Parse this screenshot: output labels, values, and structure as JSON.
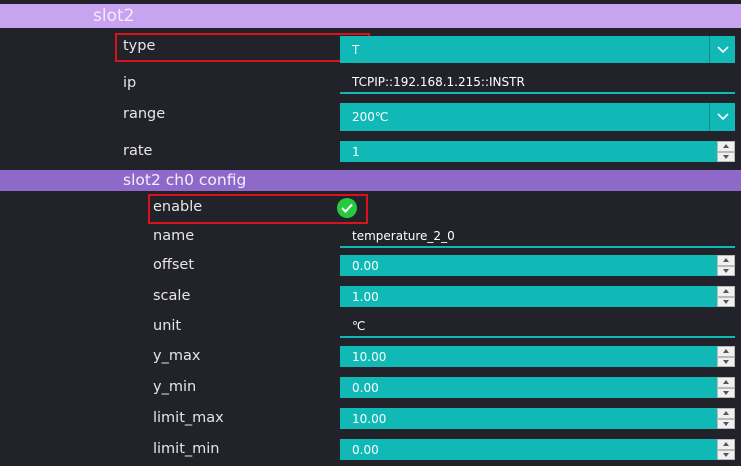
{
  "slot": {
    "title": "slot2",
    "type": {
      "label": "type",
      "value": "T"
    },
    "ip": {
      "label": "ip",
      "value": "TCPIP::192.168.1.215::INSTR"
    },
    "range": {
      "label": "range",
      "value": "200℃"
    },
    "rate": {
      "label": "rate",
      "value": "1"
    }
  },
  "channel": {
    "title": "slot2 ch0 config",
    "enable": {
      "label": "enable",
      "checked": true
    },
    "name": {
      "label": "name",
      "value": "temperature_2_0"
    },
    "offset": {
      "label": "offset",
      "value": "0.00"
    },
    "scale": {
      "label": "scale",
      "value": "1.00"
    },
    "unit": {
      "label": "unit",
      "value": "℃"
    },
    "y_max": {
      "label": "y_max",
      "value": "10.00"
    },
    "y_min": {
      "label": "y_min",
      "value": "0.00"
    },
    "limit_max": {
      "label": "limit_max",
      "value": "10.00"
    },
    "limit_min": {
      "label": "limit_min",
      "value": "0.00"
    }
  },
  "colors": {
    "background": "#22232a",
    "slot_header": "#c7a3f0",
    "channel_header": "#8f69c9",
    "field": "#10b9b6",
    "highlight": "#d9121b",
    "check": "#27c93f"
  }
}
